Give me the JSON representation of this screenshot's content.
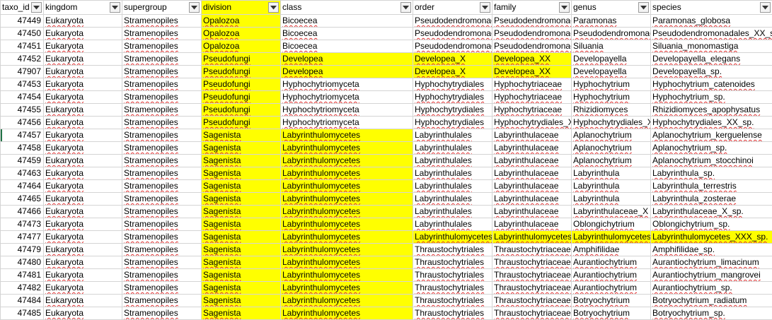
{
  "columns": [
    {
      "key": "taxo_id",
      "label": "taxo_id"
    },
    {
      "key": "kingdom",
      "label": "kingdom"
    },
    {
      "key": "supergroup",
      "label": "supergroup"
    },
    {
      "key": "division",
      "label": "division"
    },
    {
      "key": "class",
      "label": "class"
    },
    {
      "key": "order",
      "label": "order"
    },
    {
      "key": "family",
      "label": "family"
    },
    {
      "key": "genus",
      "label": "genus"
    },
    {
      "key": "species",
      "label": "species"
    }
  ],
  "highlight_color": "#ffff00",
  "spellcheck_color": "#e03030",
  "filter_icon": "dropdown-arrow-icon",
  "rows": [
    {
      "cells": [
        "47449",
        "Eukaryota",
        "Stramenopiles",
        "Opalozoa",
        "Bicoecea",
        "Pseudodendromonadales",
        "Pseudodendromonadaceae",
        "Paramonas",
        "Paramonas_globosa"
      ],
      "hl": [
        3
      ]
    },
    {
      "cells": [
        "47450",
        "Eukaryota",
        "Stramenopiles",
        "Opalozoa",
        "Bicoecea",
        "Pseudodendromonadales",
        "Pseudodendromonadaceae",
        "Pseudodendromonadales_XX",
        "Pseudodendromonadales_XX_sp."
      ],
      "hl": [
        3
      ]
    },
    {
      "cells": [
        "47451",
        "Eukaryota",
        "Stramenopiles",
        "Opalozoa",
        "Bicoecea",
        "Pseudodendromonadales",
        "Pseudodendromonadaceae",
        "Siluania",
        "Siluania_monomastiga"
      ],
      "hl": [
        3
      ]
    },
    {
      "cells": [
        "47452",
        "Eukaryota",
        "Stramenopiles",
        "Pseudofungi",
        "Developea",
        "Developea_X",
        "Developea_XX",
        "Developayella",
        "Developayella_elegans"
      ],
      "hl": [
        3,
        4,
        5,
        6
      ]
    },
    {
      "cells": [
        "47907",
        "Eukaryota",
        "Stramenopiles",
        "Pseudofungi",
        "Developea",
        "Developea_X",
        "Developea_XX",
        "Developayella",
        "Developayella_sp."
      ],
      "hl": [
        3,
        4,
        5,
        6
      ]
    },
    {
      "cells": [
        "47453",
        "Eukaryota",
        "Stramenopiles",
        "Pseudofungi",
        "Hyphochytriomyceta",
        "Hyphochytrydiales",
        "Hyphochytriaceae",
        "Hyphochytrium",
        "Hyphochytrium_catenoides"
      ],
      "hl": [
        3
      ]
    },
    {
      "cells": [
        "47454",
        "Eukaryota",
        "Stramenopiles",
        "Pseudofungi",
        "Hyphochytriomyceta",
        "Hyphochytrydiales",
        "Hyphochytriaceae",
        "Hyphochytrium",
        "Hyphochytrium_sp."
      ],
      "hl": [
        3
      ]
    },
    {
      "cells": [
        "47455",
        "Eukaryota",
        "Stramenopiles",
        "Pseudofungi",
        "Hyphochytriomyceta",
        "Hyphochytrydiales",
        "Hyphochytriaceae",
        "Rhizidiomyces",
        "Rhizidiomyces_apophysatus"
      ],
      "hl": [
        3
      ]
    },
    {
      "cells": [
        "47456",
        "Eukaryota",
        "Stramenopiles",
        "Pseudofungi",
        "Hyphochytriomyceta",
        "Hyphochytrydiales",
        "Hyphochytrydiales_X",
        "Hyphochytrydiales_XX",
        "Hyphochytrydiales_XX_sp."
      ],
      "hl": [
        3
      ]
    },
    {
      "cells": [
        "47457",
        "Eukaryota",
        "Stramenopiles",
        "Sagenista",
        "Labyrinthulomycetes",
        "Labyrinthulales",
        "Labyrinthulaceae",
        "Aplanochytrium",
        "Aplanochytrium_kerguelense"
      ],
      "hl": [
        3,
        4
      ]
    },
    {
      "cells": [
        "47458",
        "Eukaryota",
        "Stramenopiles",
        "Sagenista",
        "Labyrinthulomycetes",
        "Labyrinthulales",
        "Labyrinthulaceae",
        "Aplanochytrium",
        "Aplanochytrium_sp."
      ],
      "hl": [
        3,
        4
      ]
    },
    {
      "cells": [
        "47459",
        "Eukaryota",
        "Stramenopiles",
        "Sagenista",
        "Labyrinthulomycetes",
        "Labyrinthulales",
        "Labyrinthulaceae",
        "Aplanochytrium",
        "Aplanochytrium_stocchinoi"
      ],
      "hl": [
        3,
        4
      ]
    },
    {
      "cells": [
        "47463",
        "Eukaryota",
        "Stramenopiles",
        "Sagenista",
        "Labyrinthulomycetes",
        "Labyrinthulales",
        "Labyrinthulaceae",
        "Labyrinthula",
        "Labyrinthula_sp."
      ],
      "hl": [
        3,
        4
      ]
    },
    {
      "cells": [
        "47464",
        "Eukaryota",
        "Stramenopiles",
        "Sagenista",
        "Labyrinthulomycetes",
        "Labyrinthulales",
        "Labyrinthulaceae",
        "Labyrinthula",
        "Labyrinthula_terrestris"
      ],
      "hl": [
        3,
        4
      ]
    },
    {
      "cells": [
        "47465",
        "Eukaryota",
        "Stramenopiles",
        "Sagenista",
        "Labyrinthulomycetes",
        "Labyrinthulales",
        "Labyrinthulaceae",
        "Labyrinthula",
        "Labyrinthula_zosterae"
      ],
      "hl": [
        3,
        4
      ]
    },
    {
      "cells": [
        "47466",
        "Eukaryota",
        "Stramenopiles",
        "Sagenista",
        "Labyrinthulomycetes",
        "Labyrinthulales",
        "Labyrinthulaceae",
        "Labyrinthulaceae_X",
        "Labyrinthulaceae_X_sp."
      ],
      "hl": [
        3,
        4
      ]
    },
    {
      "cells": [
        "47473",
        "Eukaryota",
        "Stramenopiles",
        "Sagenista",
        "Labyrinthulomycetes",
        "Labyrinthulales",
        "Labyrinthulaceae",
        "Oblongichytrium",
        "Oblongichytrium_sp."
      ],
      "hl": [
        3,
        4
      ]
    },
    {
      "cells": [
        "47477",
        "Eukaryota",
        "Stramenopiles",
        "Sagenista",
        "Labyrinthulomycetes",
        "Labyrinthulomycetes_X",
        "Labyrinthulomycetes_XX",
        "Labyrinthulomycetes_XXX",
        "Labyrinthulomycetes_XXX_sp."
      ],
      "hl": [
        3,
        4,
        5,
        6,
        7,
        8
      ]
    },
    {
      "cells": [
        "47479",
        "Eukaryota",
        "Stramenopiles",
        "Sagenista",
        "Labyrinthulomycetes",
        "Thraustochytriales",
        "Thraustochytriaceae",
        "Amphifilidae",
        "Amphifilidae_sp."
      ],
      "hl": [
        3,
        4
      ]
    },
    {
      "cells": [
        "47480",
        "Eukaryota",
        "Stramenopiles",
        "Sagenista",
        "Labyrinthulomycetes",
        "Thraustochytriales",
        "Thraustochytriaceae",
        "Aurantiochytrium",
        "Aurantiochytrium_limacinum"
      ],
      "hl": [
        3,
        4
      ]
    },
    {
      "cells": [
        "47481",
        "Eukaryota",
        "Stramenopiles",
        "Sagenista",
        "Labyrinthulomycetes",
        "Thraustochytriales",
        "Thraustochytriaceae",
        "Aurantiochytrium",
        "Aurantiochytrium_mangrovei"
      ],
      "hl": [
        3,
        4
      ]
    },
    {
      "cells": [
        "47482",
        "Eukaryota",
        "Stramenopiles",
        "Sagenista",
        "Labyrinthulomycetes",
        "Thraustochytriales",
        "Thraustochytriaceae",
        "Aurantiochytrium",
        "Aurantiochytrium_sp."
      ],
      "hl": [
        3,
        4
      ]
    },
    {
      "cells": [
        "47484",
        "Eukaryota",
        "Stramenopiles",
        "Sagenista",
        "Labyrinthulomycetes",
        "Thraustochytriales",
        "Thraustochytriaceae",
        "Botryochytrium",
        "Botryochytrium_radiatum"
      ],
      "hl": [
        3,
        4
      ]
    },
    {
      "cells": [
        "47485",
        "Eukaryota",
        "Stramenopiles",
        "Sagenista",
        "Labyrinthulomycetes",
        "Thraustochytriales",
        "Thraustochytriaceae",
        "Botryochytrium",
        "Botryochytrium_sp."
      ],
      "hl": [
        3,
        4
      ]
    }
  ]
}
